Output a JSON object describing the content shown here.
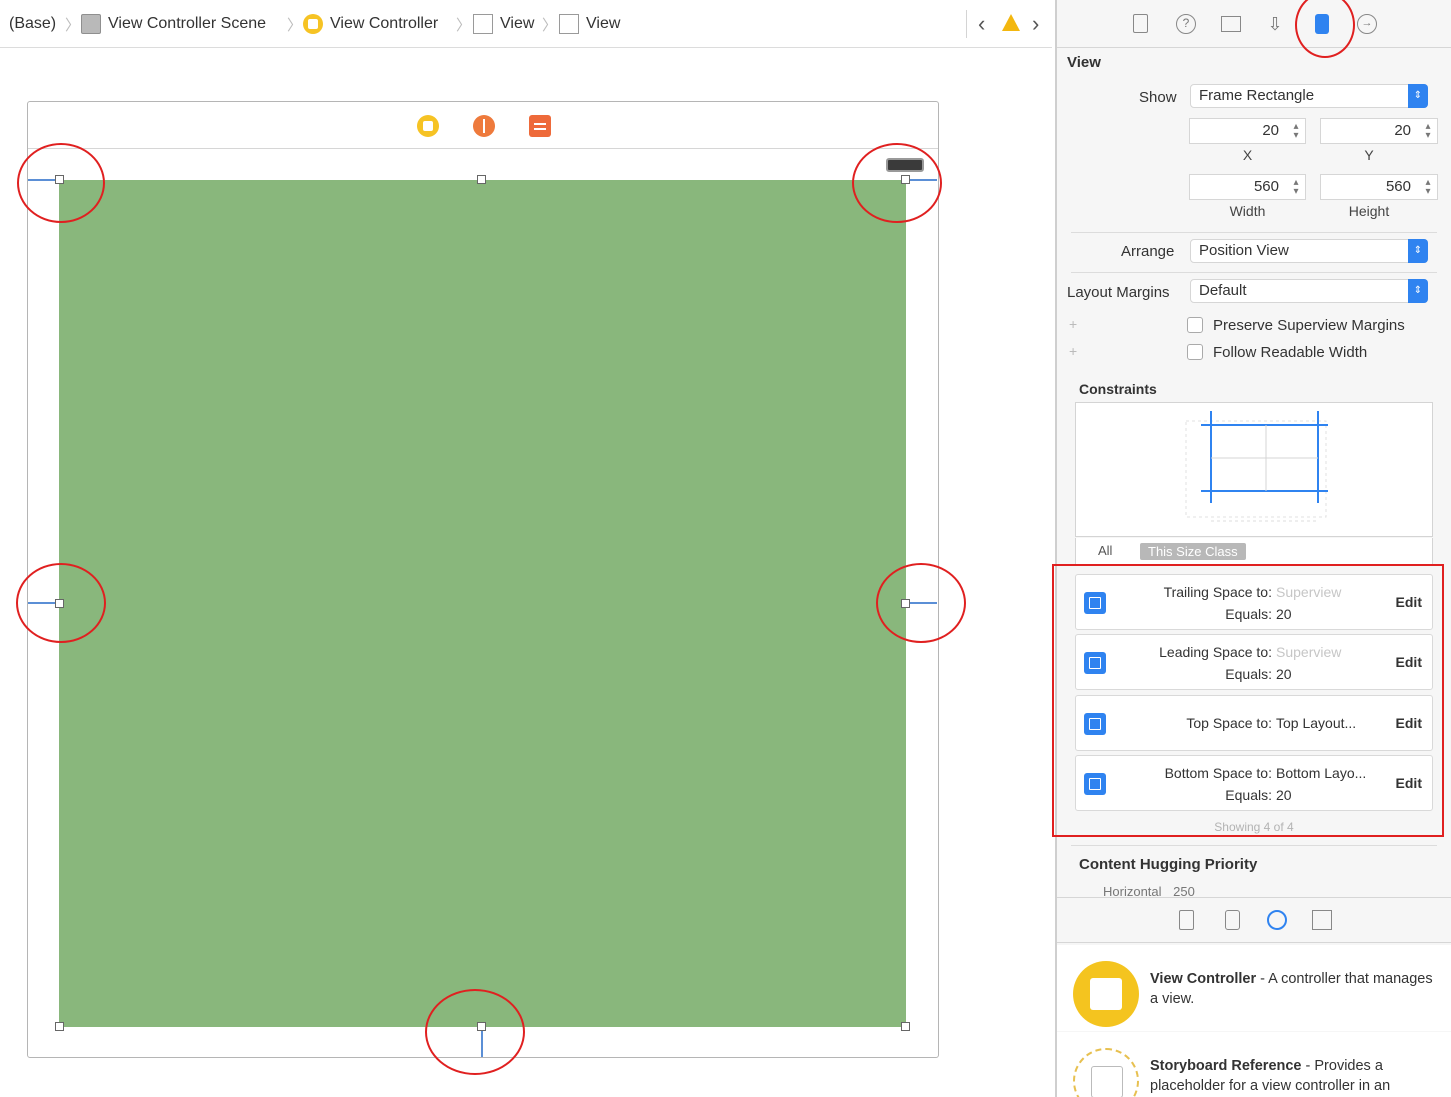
{
  "breadcrumb": {
    "items": [
      "(Base)",
      "View Controller Scene",
      "View Controller",
      "View",
      "View"
    ]
  },
  "inspector": {
    "section_title": "View",
    "show_label": "Show",
    "show_value": "Frame Rectangle",
    "x_value": "20",
    "y_value": "20",
    "x_label": "X",
    "y_label": "Y",
    "width_value": "560",
    "height_value": "560",
    "width_label": "Width",
    "height_label": "Height",
    "arrange_label": "Arrange",
    "arrange_value": "Position View",
    "layout_margins_label": "Layout Margins",
    "layout_margins_value": "Default",
    "preserve_label": "Preserve Superview Margins",
    "follow_label": "Follow Readable Width",
    "constraints_title": "Constraints",
    "seg_all": "All",
    "seg_size_class": "This Size Class",
    "constraints": [
      {
        "line1_key": "Trailing Space to:",
        "line1_value": "Superview",
        "line2_key": "Equals:",
        "line2_value": "20",
        "edit": "Edit"
      },
      {
        "line1_key": "Leading Space to:",
        "line1_value": "Superview",
        "line2_key": "Equals:",
        "line2_value": "20",
        "edit": "Edit"
      },
      {
        "line1_key": "Top Space to:",
        "line1_value": "Top Layout...",
        "edit": "Edit"
      },
      {
        "line1_key": "Bottom Space to:",
        "line1_value": "Bottom Layo...",
        "line2_key": "Equals:",
        "line2_value": "20",
        "edit": "Edit"
      }
    ],
    "showing": "Showing 4 of 4",
    "hugging_title": "Content Hugging Priority",
    "hugging_horizontal_label": "Horizontal",
    "hugging_horizontal_value": "250"
  },
  "library": {
    "items": [
      {
        "name": "View Controller",
        "desc": " - A controller that manages a view."
      },
      {
        "name": "Storyboard Reference",
        "desc": " - Provides a placeholder for a view controller in an"
      }
    ]
  },
  "colors": {
    "view_background": "#89b77c",
    "accent": "#2f83f0",
    "highlight": "#e02020"
  }
}
